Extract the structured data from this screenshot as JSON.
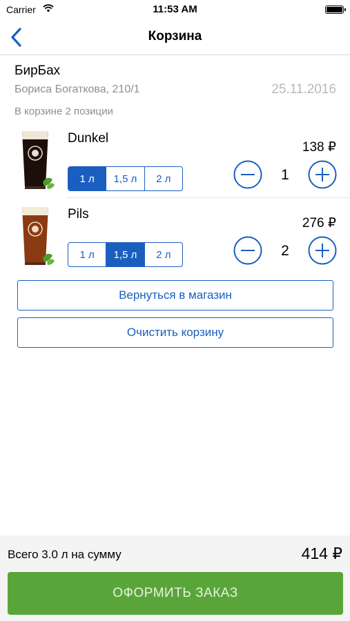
{
  "status_bar": {
    "carrier": "Carrier",
    "time": "11:53 AM"
  },
  "nav": {
    "title": "Корзина"
  },
  "shop": {
    "name": "БирБах",
    "address": "Бориса Богаткова, 210/1",
    "date": "25.11.2016",
    "count_text": "В корзине 2 позиции"
  },
  "items": [
    {
      "name": "Dunkel",
      "price": "138 ₽",
      "quantity": "1",
      "volumes": [
        "1 л",
        "1,5 л",
        "2 л"
      ],
      "selected_volume": "1 л",
      "beer_color": "#1c0f0a"
    },
    {
      "name": "Pils",
      "price": "276 ₽",
      "quantity": "2",
      "volumes": [
        "1 л",
        "1,5 л",
        "2 л"
      ],
      "selected_volume": "1,5 л",
      "beer_color": "#8a3a12"
    }
  ],
  "actions": {
    "back_to_shop": "Вернуться в магазин",
    "clear_cart": "Очистить корзину"
  },
  "footer": {
    "total_label": "Всего 3.0 л на сумму",
    "total_amount": "414 ₽",
    "checkout": "ОФОРМИТЬ ЗАКАЗ"
  },
  "colors": {
    "accent": "#1a5fbf",
    "checkout_green": "#5aa53a"
  }
}
